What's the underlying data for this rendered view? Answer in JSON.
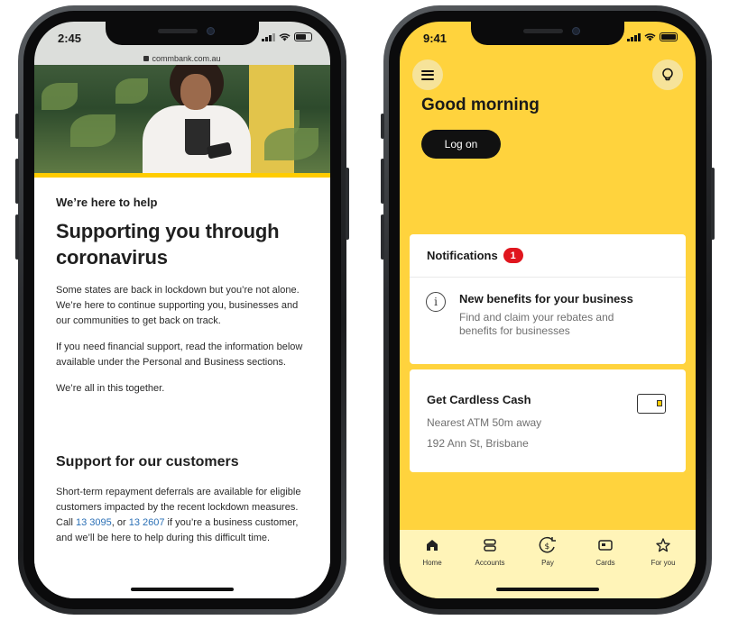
{
  "left_phone": {
    "status_time": "2:45",
    "url": "commbank.com.au",
    "eyebrow": "We’re here to help",
    "headline": "Supporting you through coronavirus",
    "paragraphs": [
      "Some states are back in lockdown but you’re not alone. We’re here to continue supporting you, businesses and our communities to get back on track.",
      "If you need financial support, read the information below available under the Personal and Business sections.",
      "We’re all in this together."
    ],
    "section_title": "Support for our customers",
    "section_body": {
      "text_before": "Short-term repayment deferrals are available for eligible customers impacted by the recent lockdown measures. Call ",
      "phone_1": "13 3095",
      "text_middle": ", or ",
      "phone_2": "13 2607",
      "text_after": " if you’re a business customer, and we’ll be here to help during this difficult time."
    }
  },
  "right_phone": {
    "status_time": "9:41",
    "greeting": "Good morning",
    "logon_label": "Log on",
    "notifications": {
      "title": "Notifications",
      "count": "1",
      "item_title": "New benefits for your business",
      "item_desc": "Find and claim your rebates and benefits for businesses"
    },
    "cardless_cash": {
      "title": "Get Cardless Cash",
      "line1": "Nearest ATM 50m away",
      "line2": "192 Ann St, Brisbane"
    },
    "tabs": [
      {
        "label": "Home",
        "icon": "home-icon"
      },
      {
        "label": "Accounts",
        "icon": "accounts-icon"
      },
      {
        "label": "Pay",
        "icon": "pay-icon"
      },
      {
        "label": "Cards",
        "icon": "cards-icon"
      },
      {
        "label": "For you",
        "icon": "star-icon"
      }
    ],
    "colors": {
      "brand_yellow": "#ffd33d",
      "badge_red": "#e0161e",
      "text_dark": "#1a1a1a"
    }
  }
}
